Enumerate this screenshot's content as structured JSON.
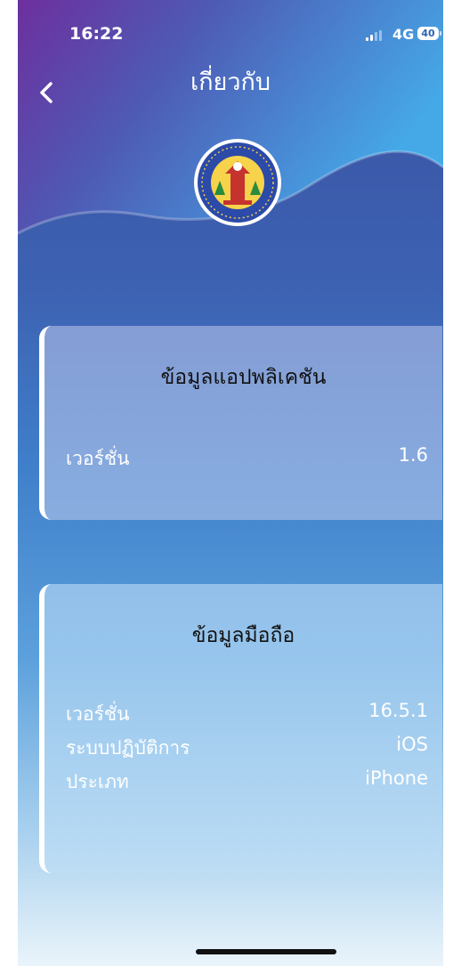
{
  "status_bar": {
    "time": "16:22",
    "network": "4G",
    "battery": "40"
  },
  "header": {
    "title": "เกี่ยวกับ"
  },
  "app_info": {
    "title": "ข้อมูลแอปพลิเคชัน",
    "version_label": "เวอร์ชั่น",
    "version_value": "1.6"
  },
  "device_info": {
    "title": "ข้อมูลมือถือ",
    "rows": [
      {
        "label": "เวอร์ชั่น",
        "value": "16.5.1"
      },
      {
        "label": "ระบบปฏิบัติการ",
        "value": "iOS"
      },
      {
        "label": "ประเภท",
        "value": "iPhone"
      }
    ]
  },
  "colors": {
    "accent_purple": "#6d2f9e",
    "accent_blue": "#3f7fca",
    "card_border": "#ffffff"
  },
  "icons": [
    "back-chevron-icon",
    "signal-icon",
    "battery-icon"
  ]
}
